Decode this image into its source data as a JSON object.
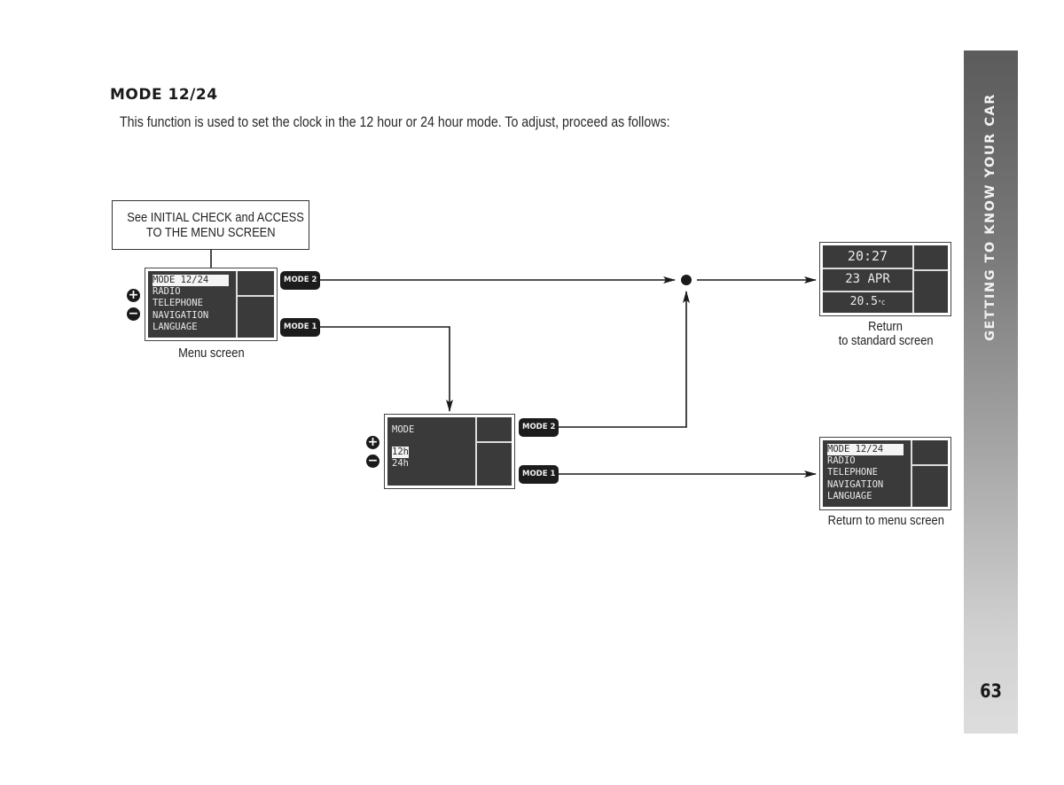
{
  "section": {
    "title": "MODE 12/24",
    "intro": "This function is used to set the clock in the 12 hour or 24 hour mode. To adjust, proceed as follows:"
  },
  "diagram": {
    "note_box": {
      "line1": "See INITIAL CHECK and ACCESS",
      "line2": "TO THE MENU SCREEN"
    },
    "menu_screen": {
      "items": [
        "MODE 12/24",
        "RADIO",
        "TELEPHONE",
        "NAVIGATION",
        "LANGUAGE"
      ],
      "selected_index": 0,
      "caption": "Menu screen"
    },
    "mode_screen": {
      "heading": "MODE",
      "options": [
        "12h",
        "24h"
      ],
      "selected_index": 0
    },
    "standard_screen": {
      "time": "20:27",
      "date": "23 APR",
      "temperature": "20.5",
      "temperature_unit": "°C",
      "caption_line1": "Return",
      "caption_line2": "to standard screen"
    },
    "return_menu_screen": {
      "items": [
        "MODE 12/24",
        "RADIO",
        "TELEPHONE",
        "NAVIGATION",
        "LANGUAGE"
      ],
      "selected_index": 0,
      "caption": "Return to menu screen"
    },
    "buttons": {
      "plus": "+",
      "minus": "−",
      "mode1": "MODE 1",
      "mode2": "MODE 2"
    },
    "icons": {
      "plus": "plus-circle-icon",
      "minus": "minus-circle-icon",
      "junction": "junction-dot"
    }
  },
  "sidebar": {
    "chapter_title": "GETTING TO KNOW YOUR CAR",
    "page_number": "63"
  }
}
